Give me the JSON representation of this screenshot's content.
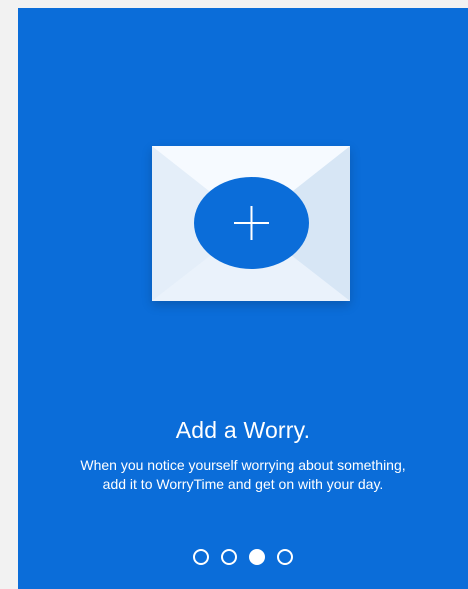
{
  "onboarding": {
    "title": "Add a Worry.",
    "description": "When you notice yourself worrying about something, add it to WorryTime and get on with your day.",
    "add_icon": "plus-icon",
    "illustration_icon": "envelope-icon",
    "pagination": {
      "total": 4,
      "active_index": 2
    }
  },
  "colors": {
    "background": "#0b6dd9",
    "envelope": "#eef5fc",
    "text": "#ffffff"
  }
}
